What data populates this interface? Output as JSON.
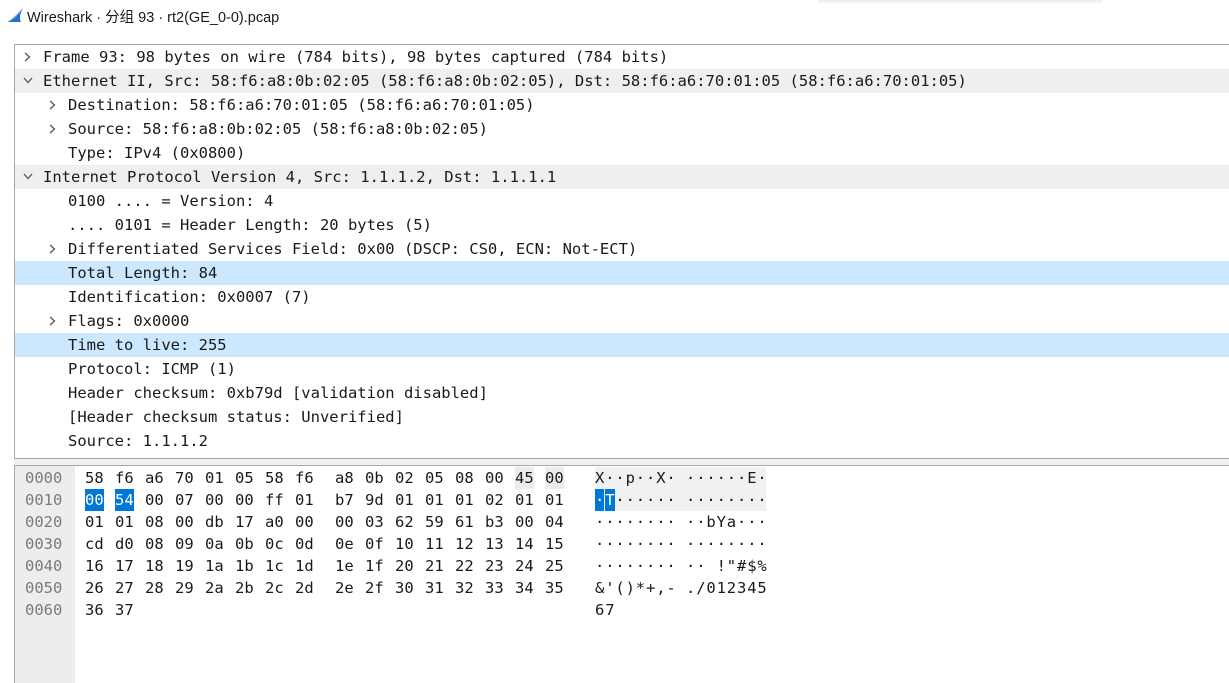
{
  "window": {
    "title": "Wireshark · 分组 93 · rt2(GE_0-0).pcap",
    "logo_icon": "wireshark-fin-icon"
  },
  "details": {
    "rows": [
      {
        "text": "Frame 93: 98 bytes on wire (784 bits), 98 bytes captured (784 bits)",
        "level": 0,
        "arrow": "collapsed",
        "style": "normal"
      },
      {
        "text": "Ethernet II, Src: 58:f6:a8:0b:02:05 (58:f6:a8:0b:02:05), Dst: 58:f6:a6:70:01:05 (58:f6:a6:70:01:05)",
        "level": 0,
        "arrow": "expanded",
        "style": "header"
      },
      {
        "text": "Destination: 58:f6:a6:70:01:05 (58:f6:a6:70:01:05)",
        "level": 1,
        "arrow": "collapsed",
        "style": "normal"
      },
      {
        "text": "Source: 58:f6:a8:0b:02:05 (58:f6:a8:0b:02:05)",
        "level": 1,
        "arrow": "collapsed",
        "style": "normal"
      },
      {
        "text": "Type: IPv4 (0x0800)",
        "level": 1,
        "arrow": "none",
        "style": "normal"
      },
      {
        "text": "Internet Protocol Version 4, Src: 1.1.1.2, Dst: 1.1.1.1",
        "level": 0,
        "arrow": "expanded",
        "style": "header"
      },
      {
        "text": "0100 .... = Version: 4",
        "level": 1,
        "arrow": "none",
        "style": "normal"
      },
      {
        "text": ".... 0101 = Header Length: 20 bytes (5)",
        "level": 1,
        "arrow": "none",
        "style": "normal"
      },
      {
        "text": "Differentiated Services Field: 0x00 (DSCP: CS0, ECN: Not-ECT)",
        "level": 1,
        "arrow": "collapsed",
        "style": "normal"
      },
      {
        "text": "Total Length: 84",
        "level": 1,
        "arrow": "none",
        "style": "selected"
      },
      {
        "text": "Identification: 0x0007 (7)",
        "level": 1,
        "arrow": "none",
        "style": "normal"
      },
      {
        "text": "Flags: 0x0000",
        "level": 1,
        "arrow": "collapsed",
        "style": "normal"
      },
      {
        "text": "Time to live: 255",
        "level": 1,
        "arrow": "none",
        "style": "selected"
      },
      {
        "text": "Protocol: ICMP (1)",
        "level": 1,
        "arrow": "none",
        "style": "normal"
      },
      {
        "text": "Header checksum: 0xb79d [validation disabled]",
        "level": 1,
        "arrow": "none",
        "style": "normal"
      },
      {
        "text": "[Header checksum status: Unverified]",
        "level": 1,
        "arrow": "none",
        "style": "normal"
      },
      {
        "text": "Source: 1.1.1.2",
        "level": 1,
        "arrow": "none",
        "style": "normal"
      }
    ]
  },
  "hex": {
    "lines": [
      {
        "offset": "0000",
        "bytes": [
          "58",
          "f6",
          "a6",
          "70",
          "01",
          "05",
          "58",
          "f6",
          "a8",
          "0b",
          "02",
          "05",
          "08",
          "00",
          "45",
          "00"
        ],
        "ascii": [
          "X",
          "·",
          "·",
          "p",
          "·",
          "·",
          "X",
          "·",
          "·",
          "·",
          "·",
          "·",
          "·",
          "·",
          "E",
          "·"
        ]
      },
      {
        "offset": "0010",
        "bytes": [
          "00",
          "54",
          "00",
          "07",
          "00",
          "00",
          "ff",
          "01",
          "b7",
          "9d",
          "01",
          "01",
          "01",
          "02",
          "01",
          "01"
        ],
        "ascii": [
          "·",
          "T",
          "·",
          "·",
          "·",
          "·",
          "·",
          "·",
          "·",
          "·",
          "·",
          "·",
          "·",
          "·",
          "·",
          "·"
        ]
      },
      {
        "offset": "0020",
        "bytes": [
          "01",
          "01",
          "08",
          "00",
          "db",
          "17",
          "a0",
          "00",
          "00",
          "03",
          "62",
          "59",
          "61",
          "b3",
          "00",
          "04"
        ],
        "ascii": [
          "·",
          "·",
          "·",
          "·",
          "·",
          "·",
          "·",
          "·",
          "·",
          "·",
          "b",
          "Y",
          "a",
          "·",
          "·",
          "·"
        ]
      },
      {
        "offset": "0030",
        "bytes": [
          "cd",
          "d0",
          "08",
          "09",
          "0a",
          "0b",
          "0c",
          "0d",
          "0e",
          "0f",
          "10",
          "11",
          "12",
          "13",
          "14",
          "15"
        ],
        "ascii": [
          "·",
          "·",
          "·",
          "·",
          "·",
          "·",
          "·",
          "·",
          "·",
          "·",
          "·",
          "·",
          "·",
          "·",
          "·",
          "·"
        ]
      },
      {
        "offset": "0040",
        "bytes": [
          "16",
          "17",
          "18",
          "19",
          "1a",
          "1b",
          "1c",
          "1d",
          "1e",
          "1f",
          "20",
          "21",
          "22",
          "23",
          "24",
          "25"
        ],
        "ascii": [
          "·",
          "·",
          "·",
          "·",
          "·",
          "·",
          "·",
          "·",
          "·",
          "·",
          " ",
          "!",
          "\"",
          "#",
          "$",
          "%"
        ]
      },
      {
        "offset": "0050",
        "bytes": [
          "26",
          "27",
          "28",
          "29",
          "2a",
          "2b",
          "2c",
          "2d",
          "2e",
          "2f",
          "30",
          "31",
          "32",
          "33",
          "34",
          "35"
        ],
        "ascii": [
          "&",
          "'",
          "(",
          ")",
          "*",
          "+",
          ",",
          "-",
          ".",
          "/",
          "0",
          "1",
          "2",
          "3",
          "4",
          "5"
        ]
      },
      {
        "offset": "0060",
        "bytes": [
          "36",
          "37"
        ],
        "ascii": [
          "6",
          "7"
        ]
      }
    ],
    "selected_bytes": [
      [
        1,
        0
      ],
      [
        1,
        1
      ]
    ],
    "highlighted_bytes": [
      [
        0,
        14
      ],
      [
        0,
        15
      ]
    ],
    "colors": {
      "selection": "#0078d7",
      "row_highlight": "#cce8ff",
      "header_row": "#efefef"
    }
  }
}
